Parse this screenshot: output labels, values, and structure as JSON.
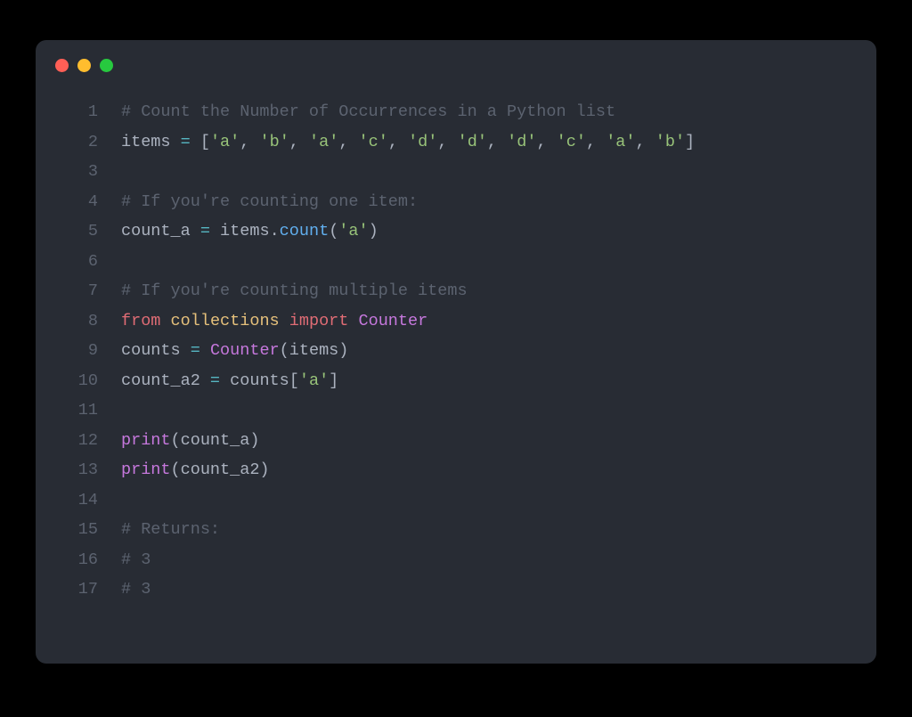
{
  "window": {
    "traffic_lights": [
      "close",
      "minimize",
      "maximize"
    ]
  },
  "code": {
    "lines": [
      {
        "num": "1",
        "tokens": [
          {
            "cls": "comment",
            "t": "# Count the Number of Occurrences in a Python list"
          }
        ]
      },
      {
        "num": "2",
        "tokens": [
          {
            "cls": "ident",
            "t": "items "
          },
          {
            "cls": "op",
            "t": "="
          },
          {
            "cls": "punct",
            "t": " ["
          },
          {
            "cls": "string",
            "t": "'a'"
          },
          {
            "cls": "punct",
            "t": ", "
          },
          {
            "cls": "string",
            "t": "'b'"
          },
          {
            "cls": "punct",
            "t": ", "
          },
          {
            "cls": "string",
            "t": "'a'"
          },
          {
            "cls": "punct",
            "t": ", "
          },
          {
            "cls": "string",
            "t": "'c'"
          },
          {
            "cls": "punct",
            "t": ", "
          },
          {
            "cls": "string",
            "t": "'d'"
          },
          {
            "cls": "punct",
            "t": ", "
          },
          {
            "cls": "string",
            "t": "'d'"
          },
          {
            "cls": "punct",
            "t": ", "
          },
          {
            "cls": "string",
            "t": "'d'"
          },
          {
            "cls": "punct",
            "t": ", "
          },
          {
            "cls": "string",
            "t": "'c'"
          },
          {
            "cls": "punct",
            "t": ", "
          },
          {
            "cls": "string",
            "t": "'a'"
          },
          {
            "cls": "punct",
            "t": ", "
          },
          {
            "cls": "string",
            "t": "'b'"
          },
          {
            "cls": "punct",
            "t": "]"
          }
        ]
      },
      {
        "num": "3",
        "tokens": []
      },
      {
        "num": "4",
        "tokens": [
          {
            "cls": "comment",
            "t": "# If you're counting one item:"
          }
        ]
      },
      {
        "num": "5",
        "tokens": [
          {
            "cls": "ident",
            "t": "count_a "
          },
          {
            "cls": "op",
            "t": "="
          },
          {
            "cls": "ident",
            "t": " items"
          },
          {
            "cls": "punct",
            "t": "."
          },
          {
            "cls": "func",
            "t": "count"
          },
          {
            "cls": "punct",
            "t": "("
          },
          {
            "cls": "string",
            "t": "'a'"
          },
          {
            "cls": "punct",
            "t": ")"
          }
        ]
      },
      {
        "num": "6",
        "tokens": []
      },
      {
        "num": "7",
        "tokens": [
          {
            "cls": "comment",
            "t": "# If you're counting multiple items"
          }
        ]
      },
      {
        "num": "8",
        "tokens": [
          {
            "cls": "redkw",
            "t": "from"
          },
          {
            "cls": "ident",
            "t": " "
          },
          {
            "cls": "objname",
            "t": "collections"
          },
          {
            "cls": "ident",
            "t": " "
          },
          {
            "cls": "redkw",
            "t": "import"
          },
          {
            "cls": "ident",
            "t": " "
          },
          {
            "cls": "keyword",
            "t": "Counter"
          }
        ]
      },
      {
        "num": "9",
        "tokens": [
          {
            "cls": "ident",
            "t": "counts "
          },
          {
            "cls": "op",
            "t": "="
          },
          {
            "cls": "ident",
            "t": " "
          },
          {
            "cls": "keyword",
            "t": "Counter"
          },
          {
            "cls": "punct",
            "t": "(items)"
          }
        ]
      },
      {
        "num": "10",
        "tokens": [
          {
            "cls": "ident",
            "t": "count_a2 "
          },
          {
            "cls": "op",
            "t": "="
          },
          {
            "cls": "ident",
            "t": " counts["
          },
          {
            "cls": "string",
            "t": "'a'"
          },
          {
            "cls": "ident",
            "t": "]"
          }
        ]
      },
      {
        "num": "11",
        "tokens": []
      },
      {
        "num": "12",
        "tokens": [
          {
            "cls": "keyword",
            "t": "print"
          },
          {
            "cls": "punct",
            "t": "(count_a)"
          }
        ]
      },
      {
        "num": "13",
        "tokens": [
          {
            "cls": "keyword",
            "t": "print"
          },
          {
            "cls": "punct",
            "t": "(count_a2)"
          }
        ]
      },
      {
        "num": "14",
        "tokens": []
      },
      {
        "num": "15",
        "tokens": [
          {
            "cls": "comment",
            "t": "# Returns:"
          }
        ]
      },
      {
        "num": "16",
        "tokens": [
          {
            "cls": "comment",
            "t": "# 3"
          }
        ]
      },
      {
        "num": "17",
        "tokens": [
          {
            "cls": "comment",
            "t": "# 3"
          }
        ]
      }
    ]
  }
}
